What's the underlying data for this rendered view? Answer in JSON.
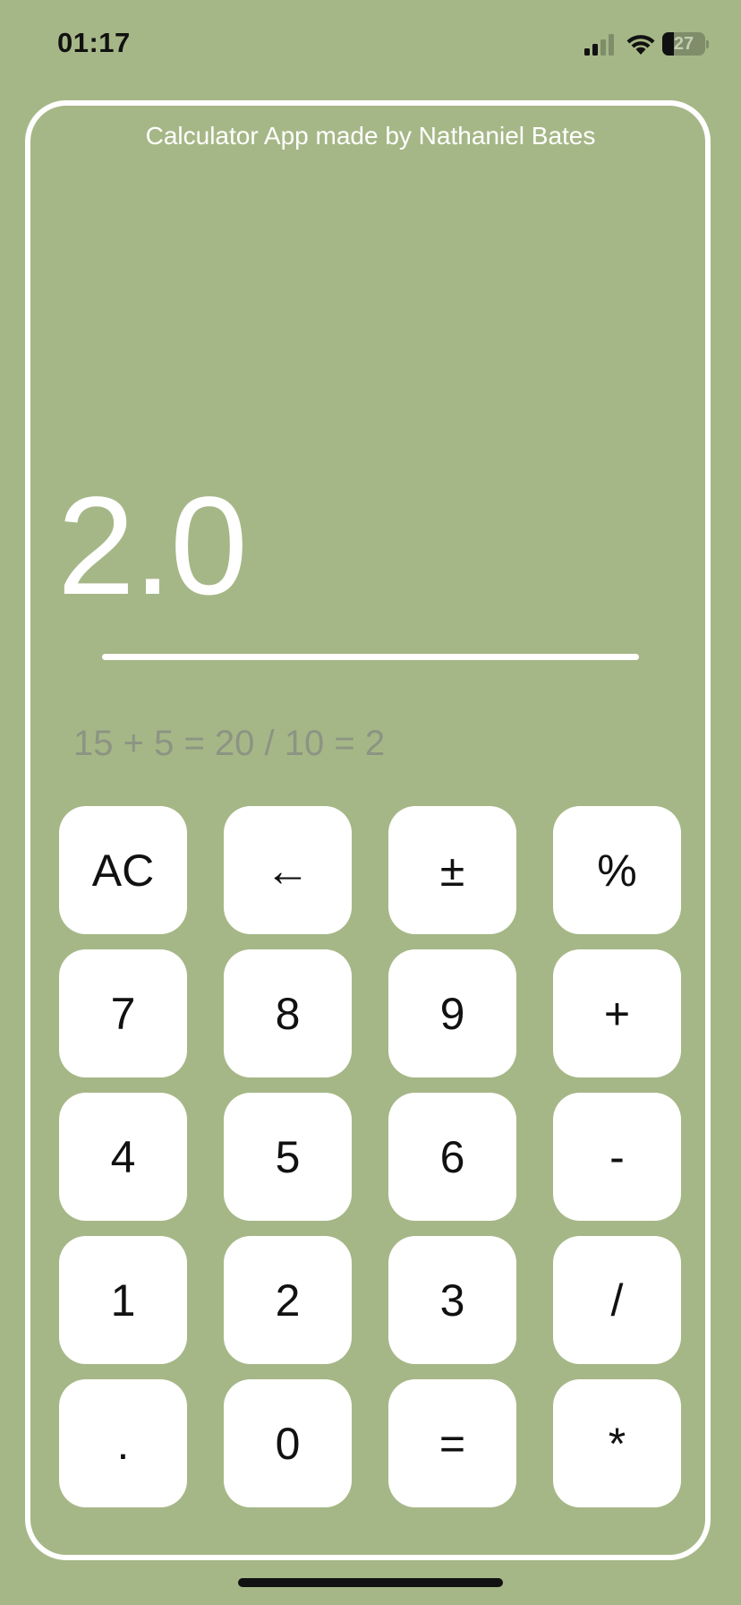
{
  "status_bar": {
    "time": "01:17",
    "battery_level": "27",
    "battery_fraction": 0.27,
    "signal_icon": "cellular-signal-icon",
    "wifi_icon": "wifi-icon",
    "battery_icon": "battery-icon"
  },
  "app": {
    "title": "Calculator App made by Nathaniel Bates"
  },
  "display": {
    "result": "2.0",
    "history": "15 + 5 = 20 / 10 = 2"
  },
  "keypad": {
    "keys": [
      {
        "label": "AC",
        "name": "key-all-clear"
      },
      {
        "label": "←",
        "name": "key-backspace"
      },
      {
        "label": "±",
        "name": "key-plus-minus"
      },
      {
        "label": "%",
        "name": "key-percent"
      },
      {
        "label": "7",
        "name": "key-7"
      },
      {
        "label": "8",
        "name": "key-8"
      },
      {
        "label": "9",
        "name": "key-9"
      },
      {
        "label": "+",
        "name": "key-add"
      },
      {
        "label": "4",
        "name": "key-4"
      },
      {
        "label": "5",
        "name": "key-5"
      },
      {
        "label": "6",
        "name": "key-6"
      },
      {
        "label": "-",
        "name": "key-subtract"
      },
      {
        "label": "1",
        "name": "key-1"
      },
      {
        "label": "2",
        "name": "key-2"
      },
      {
        "label": "3",
        "name": "key-3"
      },
      {
        "label": "/",
        "name": "key-divide"
      },
      {
        "label": ".",
        "name": "key-decimal"
      },
      {
        "label": "0",
        "name": "key-0"
      },
      {
        "label": "=",
        "name": "key-equals"
      },
      {
        "label": "*",
        "name": "key-multiply"
      }
    ]
  },
  "colors": {
    "background": "#a6b787",
    "key_background": "#ffffff",
    "key_text": "#111111",
    "result_text": "#ffffff",
    "history_text": "#8c9483"
  }
}
